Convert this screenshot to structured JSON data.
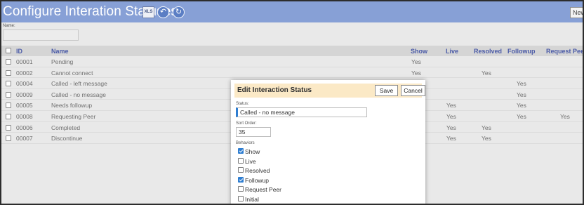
{
  "header": {
    "title": "Configure Interation Statuses",
    "xls_label": "XLS",
    "new_label": "New"
  },
  "filter": {
    "name_label": "Name:"
  },
  "grid": {
    "columns": {
      "id": "ID",
      "name": "Name",
      "show": "Show",
      "live": "Live",
      "resolved": "Resolved",
      "followup": "Followup",
      "request": "Request Peer"
    },
    "rows": [
      {
        "id": "00001",
        "name": "Pending",
        "show": "Yes",
        "live": "",
        "resolved": "",
        "followup": "",
        "request": ""
      },
      {
        "id": "00002",
        "name": "Cannot connect",
        "show": "Yes",
        "live": "",
        "resolved": "Yes",
        "followup": "",
        "request": ""
      },
      {
        "id": "00004",
        "name": "Called - left message",
        "show": "",
        "live": "",
        "resolved": "",
        "followup": "Yes",
        "request": ""
      },
      {
        "id": "00009",
        "name": "Called - no message",
        "show": "",
        "live": "",
        "resolved": "",
        "followup": "Yes",
        "request": ""
      },
      {
        "id": "00005",
        "name": "Needs followup",
        "show": "",
        "live": "Yes",
        "resolved": "",
        "followup": "Yes",
        "request": ""
      },
      {
        "id": "00008",
        "name": "Requesting Peer",
        "show": "",
        "live": "Yes",
        "resolved": "",
        "followup": "Yes",
        "request": "Yes"
      },
      {
        "id": "00006",
        "name": "Completed",
        "show": "",
        "live": "Yes",
        "resolved": "Yes",
        "followup": "",
        "request": ""
      },
      {
        "id": "00007",
        "name": "Discontinue",
        "show": "",
        "live": "Yes",
        "resolved": "Yes",
        "followup": "",
        "request": ""
      }
    ]
  },
  "dialog": {
    "title": "Edit Interaction Status",
    "save_label": "Save",
    "cancel_label": "Cancel",
    "status_label": "Status:",
    "status_value": "Called - no message",
    "sort_label": "Sort Order:",
    "sort_value": "35",
    "behaviors_label": "Behaviors",
    "behaviors": [
      {
        "label": "Show",
        "checked": true
      },
      {
        "label": "Live",
        "checked": false
      },
      {
        "label": "Resolved",
        "checked": false
      },
      {
        "label": "Followup",
        "checked": true
      },
      {
        "label": "Request Peer",
        "checked": false
      },
      {
        "label": "Initial",
        "checked": false
      }
    ]
  },
  "colors": {
    "header_bg": "#87a0d6",
    "dialog_header_bg": "#fbe9c6",
    "accent": "#2f7ed1",
    "column_header_text": "#4a5aa7"
  }
}
